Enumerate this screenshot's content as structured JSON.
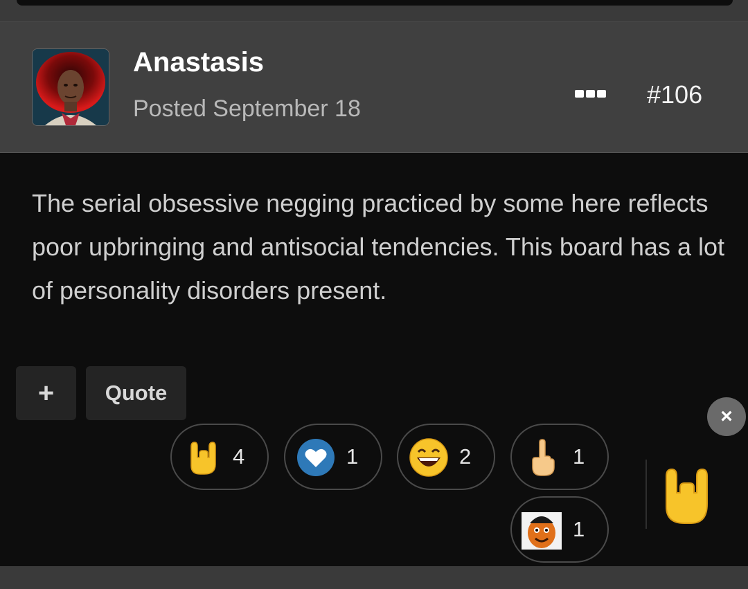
{
  "post": {
    "author": "Anastasis",
    "posted": "Posted September 18",
    "number": "#106",
    "body": "The serial obsessive negging practiced by some here reflects poor upbringing and antisocial tendencies. This board has a lot of personality disorders present."
  },
  "actions": {
    "plus_label": "+",
    "quote_label": "Quote",
    "close_label": "×"
  },
  "reactions": [
    {
      "icon": "rock-on-hand-icon",
      "count": "4"
    },
    {
      "icon": "heart-icon",
      "count": "1"
    },
    {
      "icon": "laughing-face-icon",
      "count": "2"
    },
    {
      "icon": "middle-finger-icon",
      "count": "1"
    },
    {
      "icon": "gritty-mascot-icon",
      "count": "1"
    }
  ],
  "colors": {
    "header_bg": "#404040",
    "body_bg": "#0d0d0d",
    "heart_blue": "#2e79b8",
    "emoji_yellow": "#f7c42a"
  }
}
